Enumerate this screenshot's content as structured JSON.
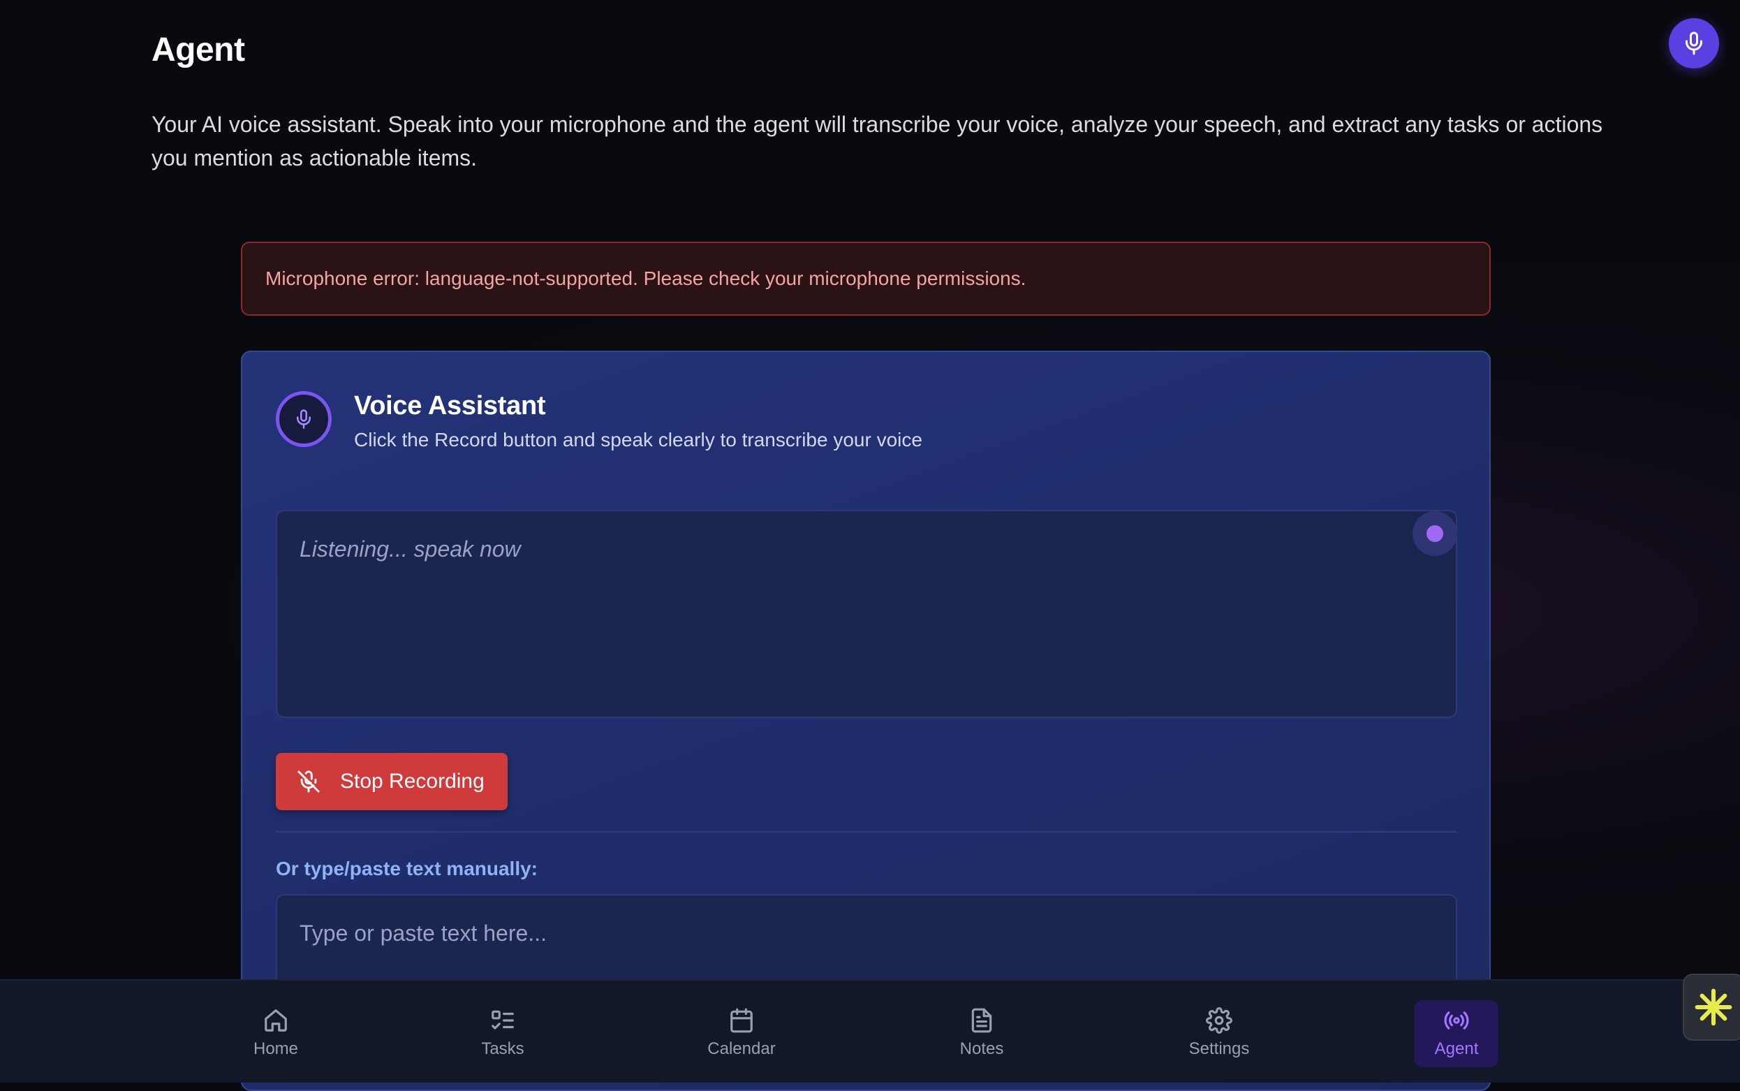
{
  "page": {
    "title": "Agent",
    "description": "Your AI voice assistant. Speak into your microphone and the agent will transcribe your voice, analyze your speech, and extract any tasks or actions you mention as actionable items."
  },
  "error": {
    "message": "Microphone error: language-not-supported. Please check your microphone permissions."
  },
  "voice_card": {
    "title": "Voice Assistant",
    "subtitle": "Click the Record button and speak clearly to transcribe your voice",
    "transcript_placeholder": "Listening... speak now",
    "stop_label": "Stop Recording",
    "manual_label": "Or type/paste text manually:",
    "manual_placeholder": "Type or paste text here..."
  },
  "nav": {
    "items": [
      {
        "label": "Home",
        "icon": "home-icon"
      },
      {
        "label": "Tasks",
        "icon": "tasks-icon"
      },
      {
        "label": "Calendar",
        "icon": "calendar-icon"
      },
      {
        "label": "Notes",
        "icon": "notes-icon"
      },
      {
        "label": "Settings",
        "icon": "gear-icon"
      },
      {
        "label": "Agent",
        "icon": "broadcast-icon",
        "active": true
      }
    ]
  },
  "colors": {
    "accent": "#7c55f0",
    "danger": "#cf3a3a",
    "card_bg": "#243378",
    "error_bg": "#2a1215"
  }
}
